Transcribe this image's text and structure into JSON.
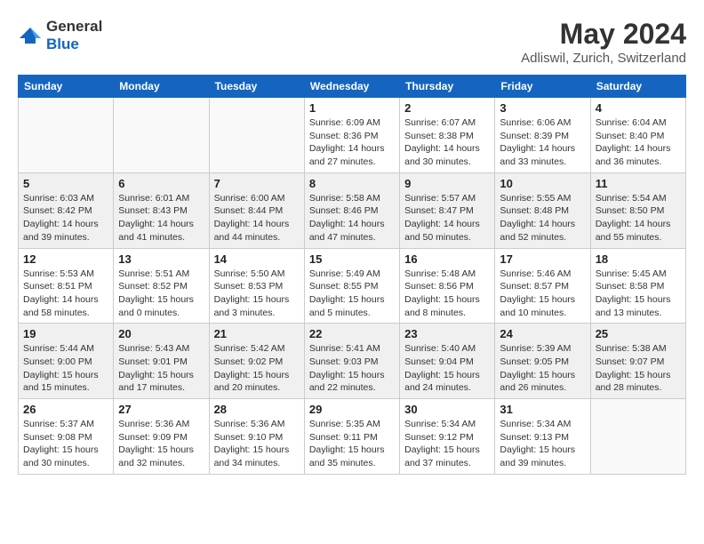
{
  "header": {
    "logo_general": "General",
    "logo_blue": "Blue",
    "title": "May 2024",
    "subtitle": "Adliswil, Zurich, Switzerland"
  },
  "weekdays": [
    "Sunday",
    "Monday",
    "Tuesday",
    "Wednesday",
    "Thursday",
    "Friday",
    "Saturday"
  ],
  "weeks": [
    [
      {
        "day": "",
        "info": ""
      },
      {
        "day": "",
        "info": ""
      },
      {
        "day": "",
        "info": ""
      },
      {
        "day": "1",
        "info": "Sunrise: 6:09 AM\nSunset: 8:36 PM\nDaylight: 14 hours\nand 27 minutes."
      },
      {
        "day": "2",
        "info": "Sunrise: 6:07 AM\nSunset: 8:38 PM\nDaylight: 14 hours\nand 30 minutes."
      },
      {
        "day": "3",
        "info": "Sunrise: 6:06 AM\nSunset: 8:39 PM\nDaylight: 14 hours\nand 33 minutes."
      },
      {
        "day": "4",
        "info": "Sunrise: 6:04 AM\nSunset: 8:40 PM\nDaylight: 14 hours\nand 36 minutes."
      }
    ],
    [
      {
        "day": "5",
        "info": "Sunrise: 6:03 AM\nSunset: 8:42 PM\nDaylight: 14 hours\nand 39 minutes."
      },
      {
        "day": "6",
        "info": "Sunrise: 6:01 AM\nSunset: 8:43 PM\nDaylight: 14 hours\nand 41 minutes."
      },
      {
        "day": "7",
        "info": "Sunrise: 6:00 AM\nSunset: 8:44 PM\nDaylight: 14 hours\nand 44 minutes."
      },
      {
        "day": "8",
        "info": "Sunrise: 5:58 AM\nSunset: 8:46 PM\nDaylight: 14 hours\nand 47 minutes."
      },
      {
        "day": "9",
        "info": "Sunrise: 5:57 AM\nSunset: 8:47 PM\nDaylight: 14 hours\nand 50 minutes."
      },
      {
        "day": "10",
        "info": "Sunrise: 5:55 AM\nSunset: 8:48 PM\nDaylight: 14 hours\nand 52 minutes."
      },
      {
        "day": "11",
        "info": "Sunrise: 5:54 AM\nSunset: 8:50 PM\nDaylight: 14 hours\nand 55 minutes."
      }
    ],
    [
      {
        "day": "12",
        "info": "Sunrise: 5:53 AM\nSunset: 8:51 PM\nDaylight: 14 hours\nand 58 minutes."
      },
      {
        "day": "13",
        "info": "Sunrise: 5:51 AM\nSunset: 8:52 PM\nDaylight: 15 hours\nand 0 minutes."
      },
      {
        "day": "14",
        "info": "Sunrise: 5:50 AM\nSunset: 8:53 PM\nDaylight: 15 hours\nand 3 minutes."
      },
      {
        "day": "15",
        "info": "Sunrise: 5:49 AM\nSunset: 8:55 PM\nDaylight: 15 hours\nand 5 minutes."
      },
      {
        "day": "16",
        "info": "Sunrise: 5:48 AM\nSunset: 8:56 PM\nDaylight: 15 hours\nand 8 minutes."
      },
      {
        "day": "17",
        "info": "Sunrise: 5:46 AM\nSunset: 8:57 PM\nDaylight: 15 hours\nand 10 minutes."
      },
      {
        "day": "18",
        "info": "Sunrise: 5:45 AM\nSunset: 8:58 PM\nDaylight: 15 hours\nand 13 minutes."
      }
    ],
    [
      {
        "day": "19",
        "info": "Sunrise: 5:44 AM\nSunset: 9:00 PM\nDaylight: 15 hours\nand 15 minutes."
      },
      {
        "day": "20",
        "info": "Sunrise: 5:43 AM\nSunset: 9:01 PM\nDaylight: 15 hours\nand 17 minutes."
      },
      {
        "day": "21",
        "info": "Sunrise: 5:42 AM\nSunset: 9:02 PM\nDaylight: 15 hours\nand 20 minutes."
      },
      {
        "day": "22",
        "info": "Sunrise: 5:41 AM\nSunset: 9:03 PM\nDaylight: 15 hours\nand 22 minutes."
      },
      {
        "day": "23",
        "info": "Sunrise: 5:40 AM\nSunset: 9:04 PM\nDaylight: 15 hours\nand 24 minutes."
      },
      {
        "day": "24",
        "info": "Sunrise: 5:39 AM\nSunset: 9:05 PM\nDaylight: 15 hours\nand 26 minutes."
      },
      {
        "day": "25",
        "info": "Sunrise: 5:38 AM\nSunset: 9:07 PM\nDaylight: 15 hours\nand 28 minutes."
      }
    ],
    [
      {
        "day": "26",
        "info": "Sunrise: 5:37 AM\nSunset: 9:08 PM\nDaylight: 15 hours\nand 30 minutes."
      },
      {
        "day": "27",
        "info": "Sunrise: 5:36 AM\nSunset: 9:09 PM\nDaylight: 15 hours\nand 32 minutes."
      },
      {
        "day": "28",
        "info": "Sunrise: 5:36 AM\nSunset: 9:10 PM\nDaylight: 15 hours\nand 34 minutes."
      },
      {
        "day": "29",
        "info": "Sunrise: 5:35 AM\nSunset: 9:11 PM\nDaylight: 15 hours\nand 35 minutes."
      },
      {
        "day": "30",
        "info": "Sunrise: 5:34 AM\nSunset: 9:12 PM\nDaylight: 15 hours\nand 37 minutes."
      },
      {
        "day": "31",
        "info": "Sunrise: 5:34 AM\nSunset: 9:13 PM\nDaylight: 15 hours\nand 39 minutes."
      },
      {
        "day": "",
        "info": ""
      }
    ]
  ]
}
